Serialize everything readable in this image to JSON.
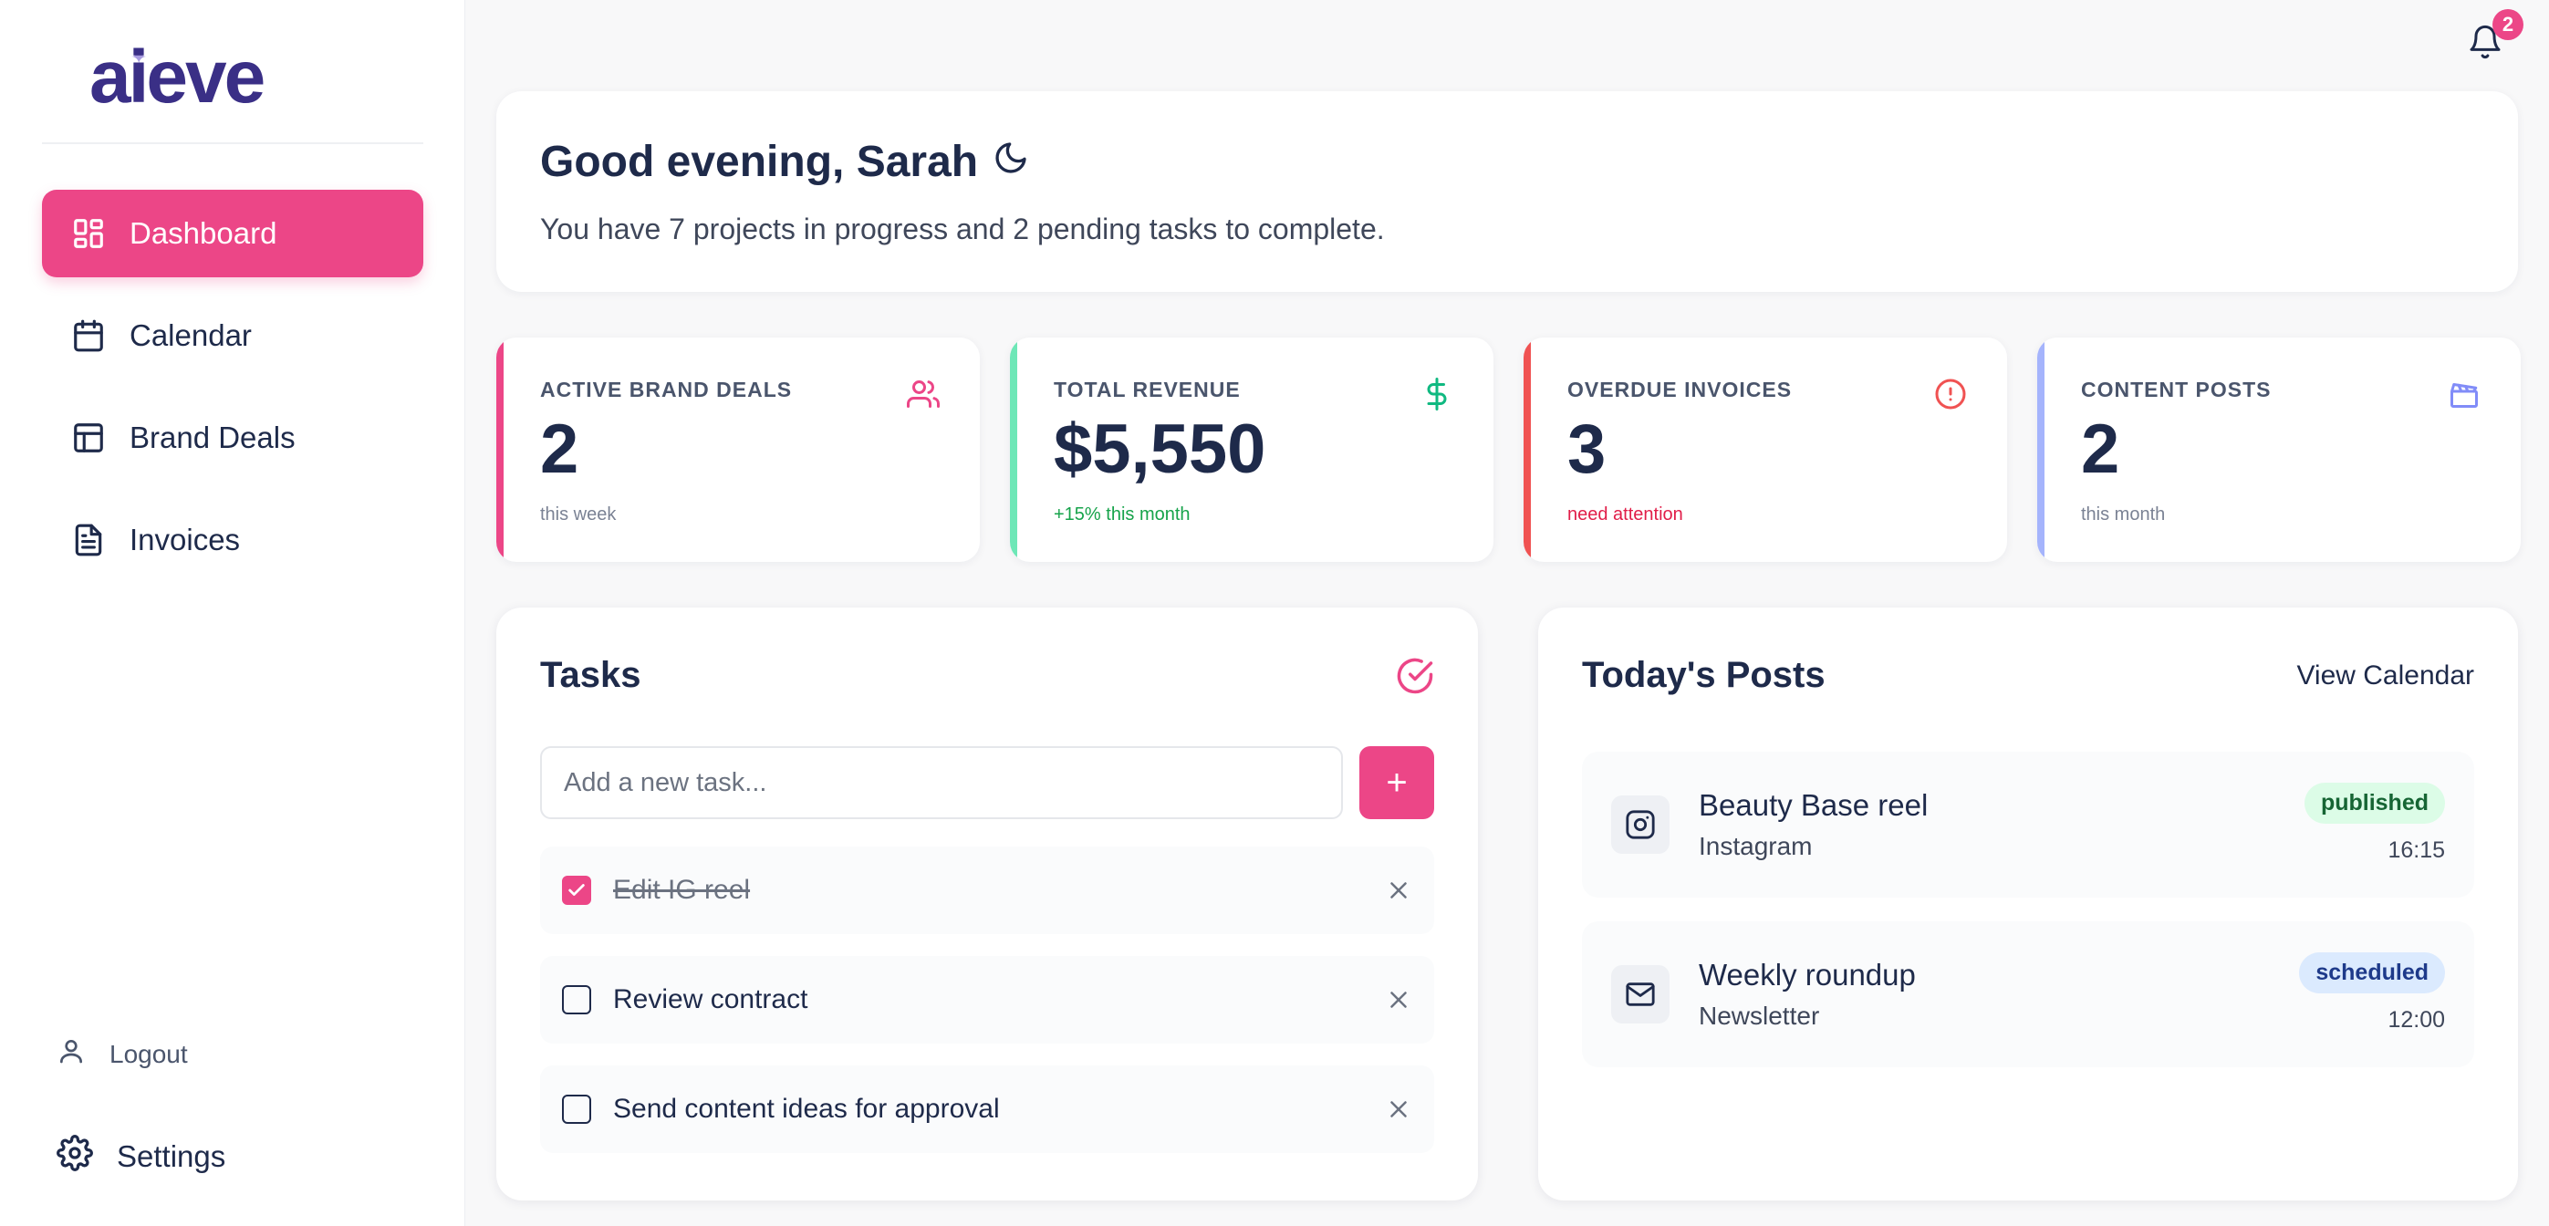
{
  "app": {
    "logo": "aieve",
    "logo_spark": "✦",
    "notification_count": "2"
  },
  "sidebar": {
    "items": [
      {
        "label": "Dashboard",
        "icon": "dashboard-grid-icon",
        "active": true
      },
      {
        "label": "Calendar",
        "icon": "calendar-icon"
      },
      {
        "label": "Brand Deals",
        "icon": "layout-icon"
      },
      {
        "label": "Invoices",
        "icon": "document-icon"
      }
    ],
    "logout_label": "Logout",
    "settings_label": "Settings"
  },
  "greeting": {
    "title": "Good evening, Sarah",
    "subtitle": "You have 7 projects in progress and 2 pending tasks to complete."
  },
  "stats": [
    {
      "label": "ACTIVE BRAND DEALS",
      "value": "2",
      "note": "this week",
      "icon": "users-icon",
      "accent": "#ec4687"
    },
    {
      "label": "TOTAL REVENUE",
      "value": "$5,550",
      "note": "+15% this month",
      "icon": "dollar-icon",
      "accent": "#6ee7b7"
    },
    {
      "label": "OVERDUE INVOICES",
      "value": "3",
      "note": "need attention",
      "icon": "alert-circle-icon",
      "accent": "#f05252"
    },
    {
      "label": "CONTENT POSTS",
      "value": "2",
      "note": "this month",
      "icon": "clapperboard-icon",
      "accent": "#a5b4fc"
    }
  ],
  "tasks": {
    "title": "Tasks",
    "input_placeholder": "Add a new task...",
    "add_label": "+",
    "items": [
      {
        "text": "Edit IG reel",
        "done": true
      },
      {
        "text": "Review contract",
        "done": false
      },
      {
        "text": "Send content ideas for approval",
        "done": false
      }
    ]
  },
  "posts": {
    "title": "Today's Posts",
    "view_calendar": "View Calendar",
    "items": [
      {
        "title": "Beauty Base reel",
        "platform": "Instagram",
        "status": "published",
        "time": "16:15",
        "icon": "instagram-icon"
      },
      {
        "title": "Weekly roundup",
        "platform": "Newsletter",
        "status": "scheduled",
        "time": "12:00",
        "icon": "mail-icon"
      }
    ]
  }
}
